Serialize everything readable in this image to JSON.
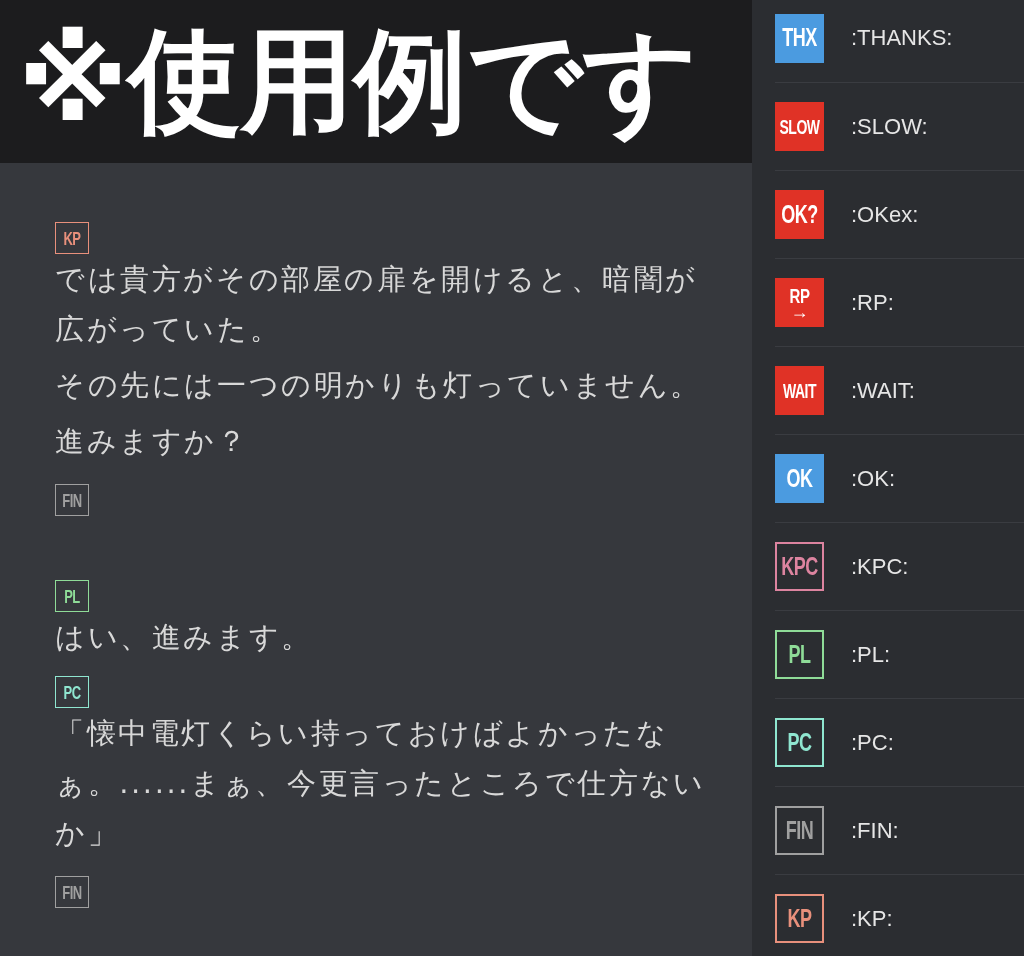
{
  "banner": {
    "title": "※使用例です"
  },
  "messages": [
    {
      "tag": {
        "text": "KP",
        "color": "#e8907c"
      },
      "paragraphs": [
        "では貴方がその部屋の扉を開けると、暗闇が広がっていた。",
        "その先には一つの明かりも灯っていません。",
        "進みますか？"
      ],
      "end_tag": {
        "text": "FIN",
        "color": "#a0a0a0"
      }
    },
    {
      "tag": {
        "text": "PL",
        "color": "#8fdc98"
      },
      "paragraphs": [
        "はい、進みます。"
      ]
    },
    {
      "tag": {
        "text": "PC",
        "color": "#8fe6d0"
      },
      "paragraphs": [
        "「懐中電灯くらい持っておけばよかったなぁ。......まぁ、今更言ったところで仕方ないか」"
      ],
      "end_tag": {
        "text": "FIN",
        "color": "#a0a0a0"
      }
    }
  ],
  "emojis": [
    {
      "kind": "filled",
      "text": "THX",
      "color": "#4b9be0",
      "name": ":THANKS:"
    },
    {
      "kind": "filled",
      "text": "SLOW",
      "color": "#e03226",
      "name": ":SLOW:"
    },
    {
      "kind": "filled",
      "text": "OK?",
      "color": "#e03226",
      "name": ":OKex:"
    },
    {
      "kind": "filled",
      "text": "RP",
      "subtext": "→",
      "color": "#e03226",
      "name": ":RP:"
    },
    {
      "kind": "filled",
      "text": "WAIT",
      "color": "#e03226",
      "name": ":WAIT:"
    },
    {
      "kind": "filled",
      "text": "OK",
      "color": "#4b9be0",
      "name": ":OK:"
    },
    {
      "kind": "outline",
      "text": "KPC",
      "color": "#dd84a0",
      "name": ":KPC:"
    },
    {
      "kind": "outline",
      "text": "PL",
      "color": "#8fdc98",
      "name": ":PL:"
    },
    {
      "kind": "outline",
      "text": "PC",
      "color": "#8fe6d0",
      "name": ":PC:"
    },
    {
      "kind": "outline",
      "text": "FIN",
      "color": "#a0a0a0",
      "name": ":FIN:"
    },
    {
      "kind": "outline",
      "text": "KP",
      "color": "#e8907c",
      "name": ":KP:"
    }
  ]
}
